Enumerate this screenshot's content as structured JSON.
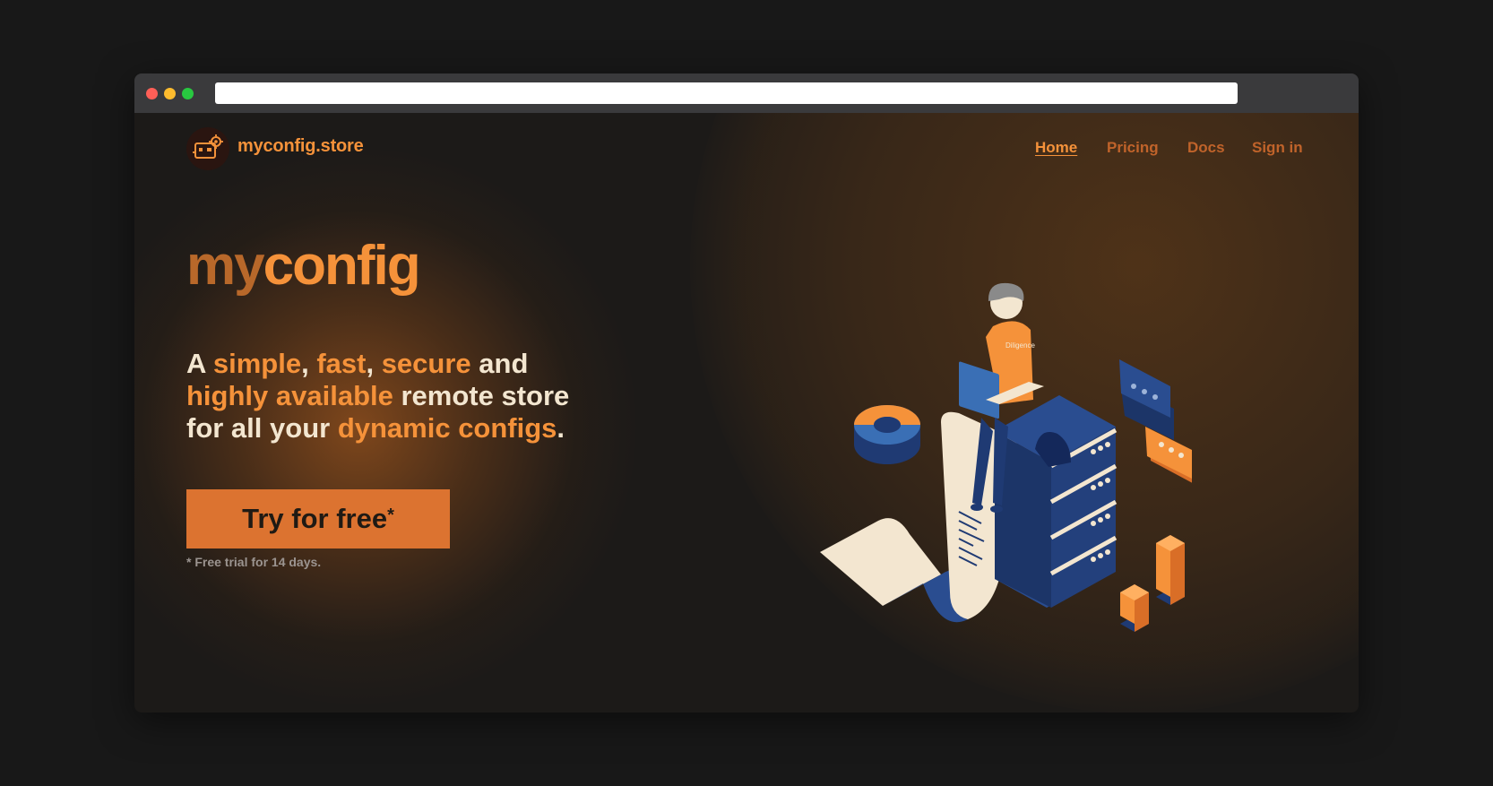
{
  "browser": {
    "url": ""
  },
  "header": {
    "brand": "myconfig.store",
    "nav": [
      {
        "label": "Home",
        "active": true
      },
      {
        "label": "Pricing",
        "active": false
      },
      {
        "label": "Docs",
        "active": false
      },
      {
        "label": "Sign in",
        "active": false
      }
    ]
  },
  "hero": {
    "title_prefix": "my",
    "title_suffix": "config",
    "tagline": {
      "p1": "A ",
      "simple": "simple",
      "p2": ", ",
      "fast": "fast",
      "p3": ", ",
      "secure": "secure",
      "p4": " and",
      "highly_available": "highly available",
      "p5": " remote store",
      "p6": "for all your ",
      "dynamic_configs": "dynamic configs",
      "p7": "."
    },
    "cta_label": "Try for free",
    "cta_mark": "*",
    "footnote": "* Free trial for 14 days.",
    "shirt_text": "Diligence"
  },
  "colors": {
    "accent": "#f5923a",
    "accent_dark": "#dc7330",
    "cream": "#f3e6d0",
    "navy": "#1f3a73",
    "background": "#1c1a18"
  }
}
